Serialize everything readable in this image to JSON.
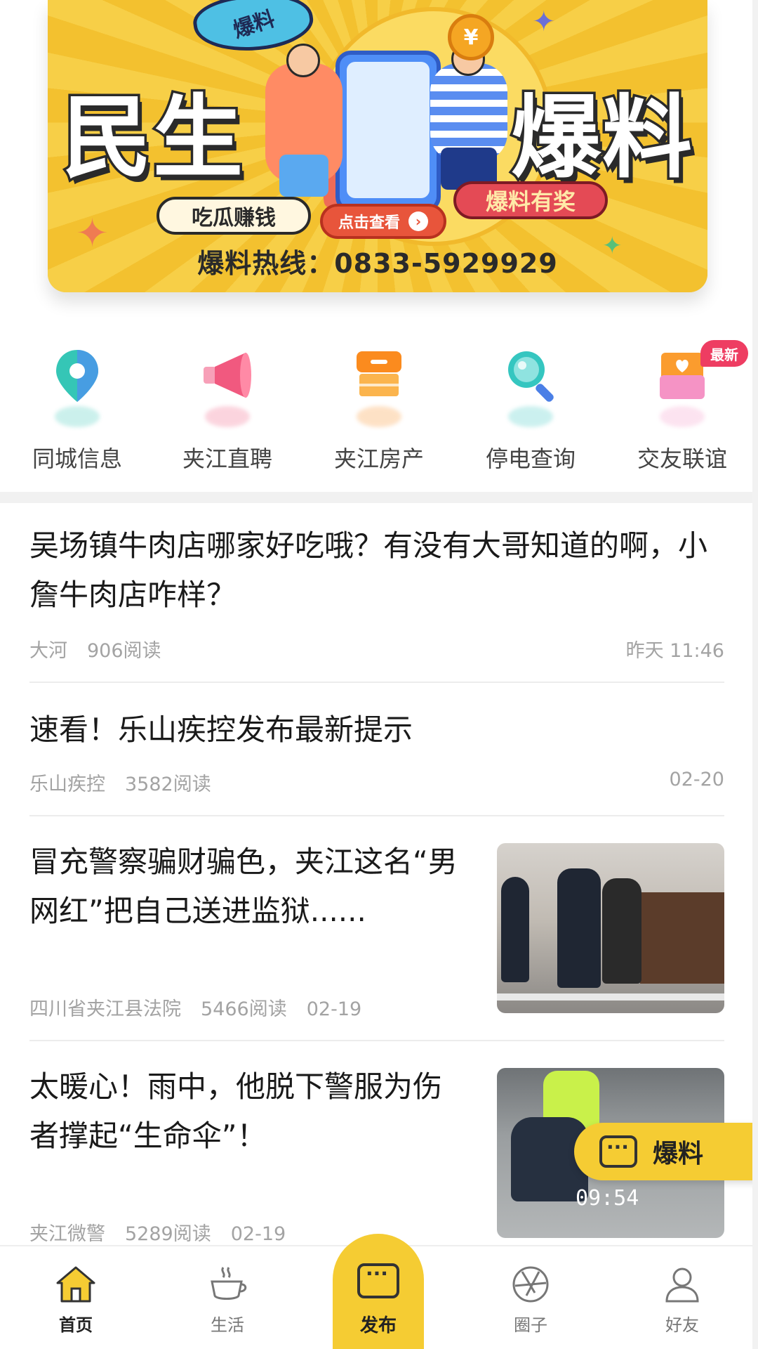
{
  "banner": {
    "burst_label": "爆料",
    "left_title": "民生",
    "right_title": "爆料",
    "pill_left": "吃瓜赚钱",
    "pill_cta": "点击查看",
    "pill_right": "爆料有奖",
    "hotline": "爆料热线：0833-5929929",
    "coin_symbol": "¥"
  },
  "quicknav": {
    "items": [
      {
        "label": "同城信息",
        "icon": "location-pin-icon"
      },
      {
        "label": "夹江直聘",
        "icon": "megaphone-icon"
      },
      {
        "label": "夹江房产",
        "icon": "shop-icon"
      },
      {
        "label": "停电查询",
        "icon": "magnifier-icon"
      },
      {
        "label": "交友联谊",
        "icon": "love-letter-icon"
      }
    ],
    "badge": "最新"
  },
  "articles": [
    {
      "title": "吴场镇牛肉店哪家好吃哦？有没有大哥知道的啊，小詹牛肉店咋样？",
      "source": "大河",
      "reads": "906阅读",
      "time": "昨天 11:46"
    },
    {
      "title": "速看！乐山疾控发布最新提示",
      "source": "乐山疾控",
      "reads": "3582阅读",
      "time": "02-20"
    },
    {
      "title": "冒充警察骗财骗色，夹江这名“男网红”把自己送进监狱......",
      "source": "四川省夹江县法院",
      "reads": "5466阅读",
      "time": "02-19"
    },
    {
      "title": "太暖心！雨中，他脱下警服为伤者撑起“生命伞”！",
      "source": "夹江微警",
      "reads": "5289阅读",
      "time": "02-19",
      "thumb_timestamp": "09:54"
    }
  ],
  "float_button": {
    "label": "爆料"
  },
  "tabbar": {
    "items": [
      {
        "label": "首页",
        "icon": "home-icon",
        "active": true
      },
      {
        "label": "生活",
        "icon": "coffee-cup-icon",
        "active": false
      },
      {
        "label": "发布",
        "icon": "chat-bubble-icon",
        "active": false
      },
      {
        "label": "圈子",
        "icon": "aperture-icon",
        "active": false
      },
      {
        "label": "好友",
        "icon": "user-icon",
        "active": false
      }
    ]
  },
  "colors": {
    "brand_yellow": "#f5cc33",
    "badge_red": "#ee3d62",
    "meta_gray": "#a3a3a3"
  }
}
